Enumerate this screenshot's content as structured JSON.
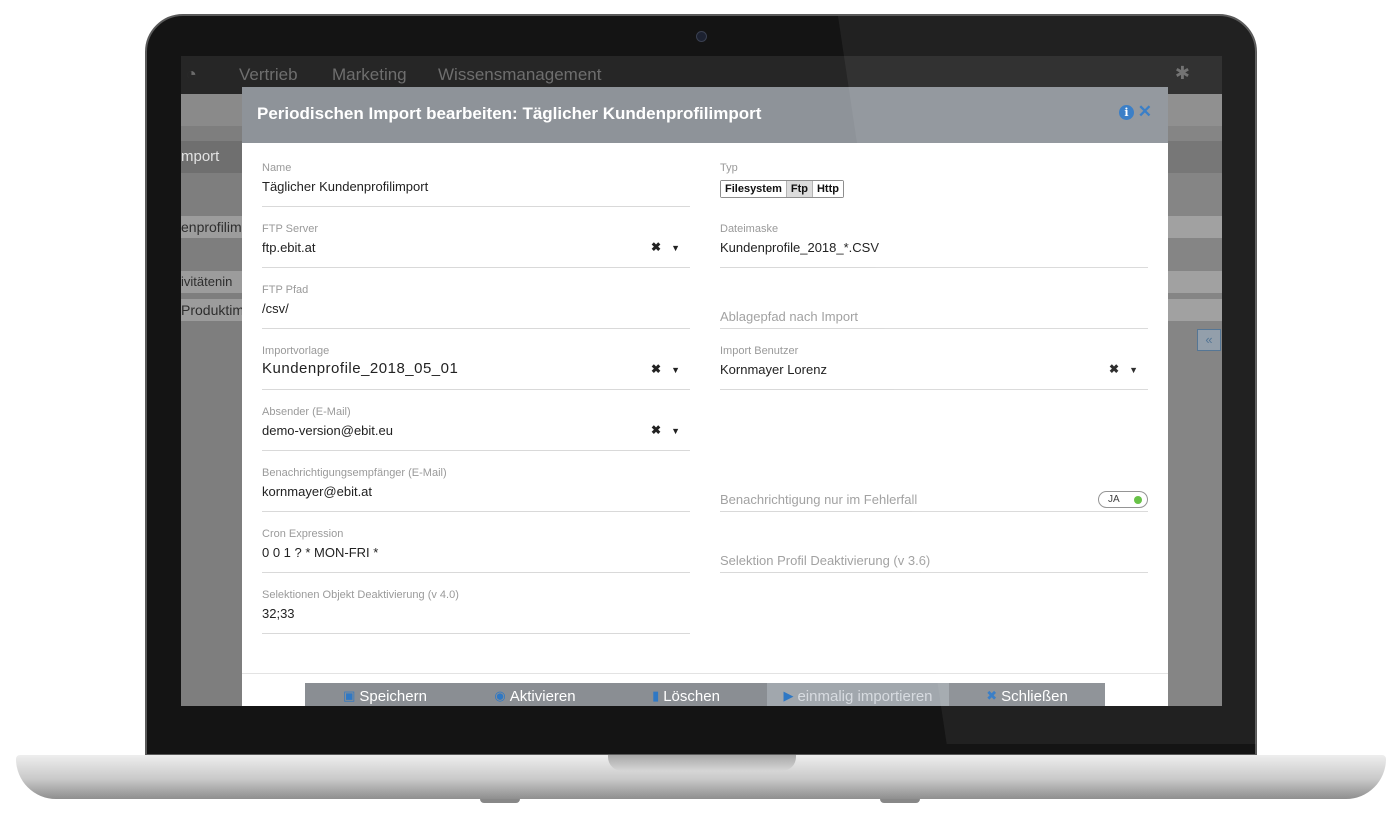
{
  "nav": {
    "items": [
      "Vertrieb",
      "Marketing",
      "Wissensmanagement"
    ]
  },
  "background": {
    "tab_label": "mport",
    "rows": [
      "enprofilim",
      "ivitätenin",
      "Produktim"
    ],
    "collapse_label": "«"
  },
  "modal": {
    "title": "Periodischen Import bearbeiten: Täglicher Kundenprofilimport",
    "fields": {
      "name": {
        "label": "Name",
        "value": "Täglicher Kundenprofilimport"
      },
      "typ": {
        "label": "Typ",
        "options": [
          "Filesystem",
          "Ftp",
          "Http"
        ],
        "selected": "Ftp"
      },
      "ftp_server": {
        "label": "FTP Server",
        "value": "ftp.ebit.at"
      },
      "dateimaske": {
        "label": "Dateimaske",
        "value": "Kundenprofile_2018_*.CSV"
      },
      "ftp_pfad": {
        "label": "FTP Pfad",
        "value": "/csv/"
      },
      "ablagepfad": {
        "placeholder": "Ablagepfad nach Import"
      },
      "importvorlage": {
        "label": "Importvorlage",
        "value": "Kundenprofile_2018_05_01"
      },
      "import_benutzer": {
        "label": "Import Benutzer",
        "value": "Kornmayer Lorenz"
      },
      "absender": {
        "label": "Absender (E-Mail)",
        "value": "demo-version@ebit.eu"
      },
      "empfaenger": {
        "label": "Benachrichtigungsempfänger (E-Mail)",
        "value": "kornmayer@ebit.at"
      },
      "fehlerfall": {
        "placeholder": "Benachrichtigung nur im Fehlerfall",
        "toggle": "JA"
      },
      "cron": {
        "label": "Cron Expression",
        "value": "0 0 1 ? * MON-FRI *"
      },
      "profil_deaktivierung": {
        "placeholder": "Selektion Profil Deaktivierung (v 3.6)"
      },
      "objekt_deaktivierung": {
        "label": "Selektionen Objekt Deaktivierung (v 4.0)",
        "value": "32;33"
      }
    },
    "buttons": {
      "save": "Speichern",
      "activate": "Aktivieren",
      "delete": "Löschen",
      "import_once": "einmalig importieren",
      "close": "Schließen"
    }
  }
}
